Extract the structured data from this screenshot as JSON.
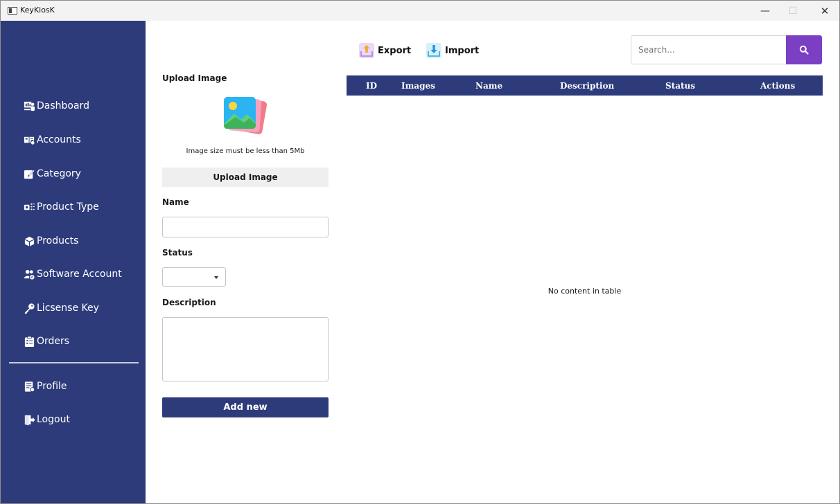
{
  "window": {
    "title": "KeyKiosK",
    "minimize": "—",
    "maximize": "☐",
    "close": "✕"
  },
  "sidebar": {
    "items": [
      {
        "label": "Dashboard",
        "icon": "dashboard-icon"
      },
      {
        "label": "Accounts",
        "icon": "accounts-icon"
      },
      {
        "label": "Category",
        "icon": "edit-icon"
      },
      {
        "label": "Product Type",
        "icon": "product-type-icon"
      },
      {
        "label": "Products",
        "icon": "box-icon"
      },
      {
        "label": "Software Account",
        "icon": "users-icon"
      },
      {
        "label": "Licsense Key",
        "icon": "key-icon"
      },
      {
        "label": "Orders",
        "icon": "clipboard-icon"
      },
      {
        "label": "Profile",
        "icon": "profile-icon"
      },
      {
        "label": "Logout",
        "icon": "logout-icon"
      }
    ]
  },
  "form": {
    "upload_title": "Upload Image",
    "upload_hint": "Image size must be less than 5Mb",
    "upload_button": "Upload Image",
    "name_label": "Name",
    "name_value": "",
    "status_label": "Status",
    "status_value": "",
    "description_label": "Description",
    "description_value": "",
    "add_button": "Add new"
  },
  "toolbar": {
    "export_label": "Export",
    "import_label": "Import",
    "search_placeholder": "Search..."
  },
  "table": {
    "columns": [
      "ID",
      "Images",
      "Name",
      "Description",
      "Status",
      "Actions"
    ],
    "rows": [],
    "empty_message": "No content in table"
  },
  "colors": {
    "sidebar_bg": "#2e3b7b",
    "accent_purple": "#7b3fc4",
    "table_header": "#2e3b7b"
  }
}
